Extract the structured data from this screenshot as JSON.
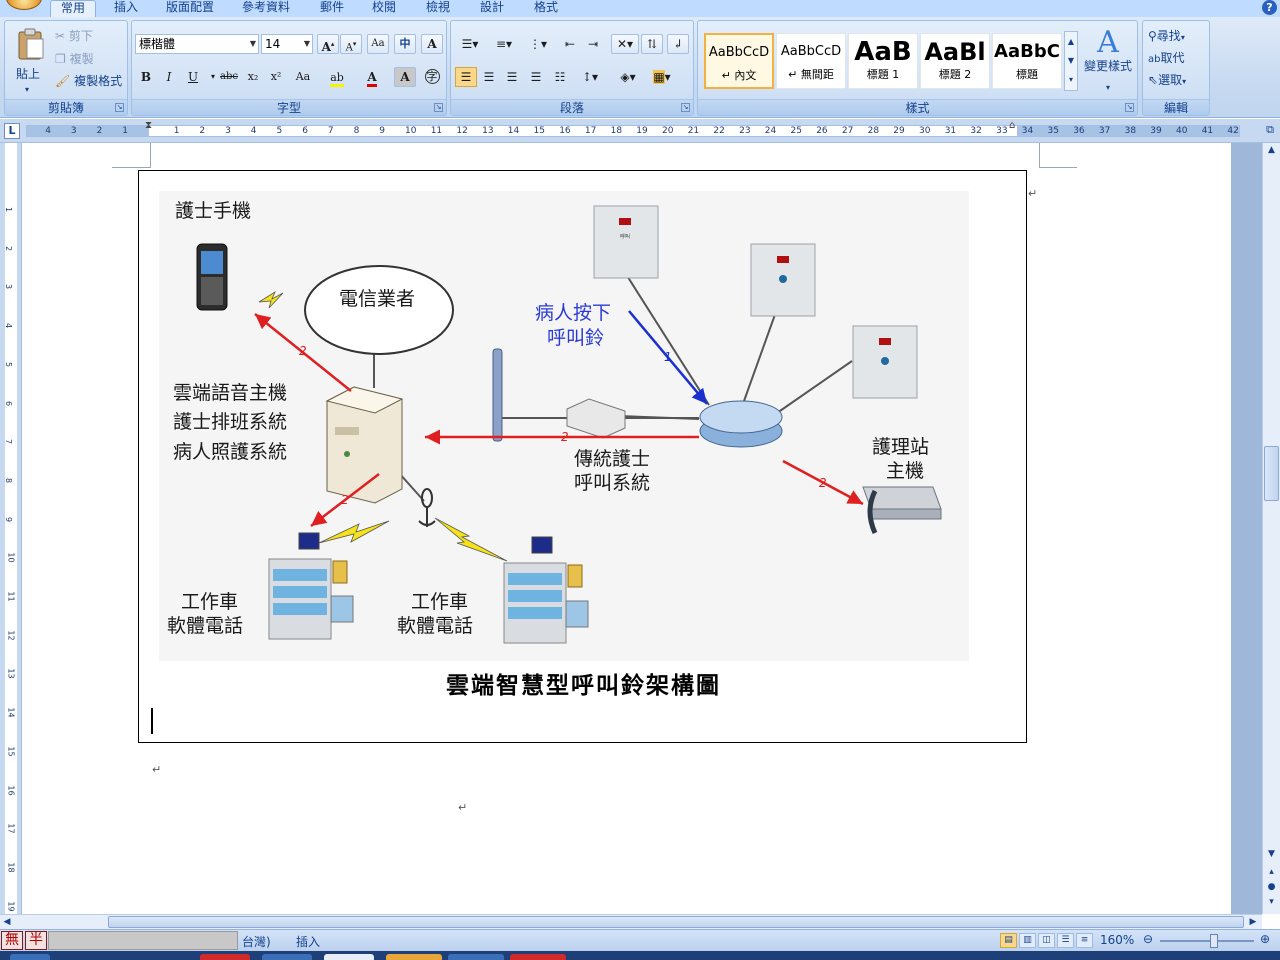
{
  "tabs": [
    "常用",
    "插入",
    "版面配置",
    "參考資料",
    "郵件",
    "校閱",
    "檢視",
    "設計",
    "格式"
  ],
  "help": "?",
  "clipboard": {
    "paste": "貼上",
    "cut": "剪下",
    "copy": "複製",
    "format_painter": "複製格式",
    "group": "剪貼簿"
  },
  "font": {
    "name": "標楷體",
    "size": "14",
    "group": "字型",
    "bold": "B",
    "italic": "I",
    "underline": "U",
    "strike": "abc",
    "subscript": "x₂",
    "superscript": "x²",
    "change_case": "Aa",
    "grow": "A",
    "shrink": "A",
    "font_color": "A",
    "char_shade": "A",
    "enclose": "字",
    "phonetic": "中"
  },
  "paragraph": {
    "group": "段落"
  },
  "styles": {
    "group": "樣式",
    "change": "變更樣式",
    "gallery": [
      {
        "preview": "AaBbCcD",
        "name": "↵ 內文"
      },
      {
        "preview": "AaBbCcD",
        "name": "↵ 無間距"
      },
      {
        "preview": "AaB",
        "name": "標題 1"
      },
      {
        "preview": "AaBl",
        "name": "標題 2"
      },
      {
        "preview": "AaBbC",
        "name": "標題"
      }
    ]
  },
  "editing": {
    "group": "編輯",
    "find": "尋找",
    "replace": "取代",
    "select": "選取"
  },
  "ruler": {
    "left_numbers": [
      "4",
      "3",
      "2",
      "1"
    ],
    "numbers": [
      "1",
      "2",
      "3",
      "4",
      "5",
      "6",
      "7",
      "8",
      "9",
      "10",
      "11",
      "12",
      "13",
      "14",
      "15",
      "16",
      "17",
      "18",
      "19",
      "20",
      "21",
      "22",
      "23",
      "24",
      "25",
      "26",
      "27",
      "28",
      "29",
      "30",
      "31",
      "32",
      "33",
      "34",
      "35",
      "36",
      "37",
      "38",
      "39",
      "40",
      "41",
      "42"
    ]
  },
  "vruler": [
    "1",
    "2",
    "3",
    "4",
    "5",
    "6",
    "7",
    "8",
    "9",
    "10",
    "11",
    "12",
    "13",
    "14",
    "15",
    "16",
    "17",
    "18",
    "19"
  ],
  "diagram": {
    "nurse_phone": "護士手機",
    "telecom": "電信業者",
    "host_line1": "雲端語音主機",
    "host_line2": "護士排班系統",
    "host_line3": "病人照護系統",
    "patient_press_1": "病人按下",
    "patient_press_2": "呼叫鈴",
    "traditional_1": "傳統護士",
    "traditional_2": "呼叫系統",
    "station_1": "護理站",
    "station_2": "主機",
    "cart_a_1": "工作車",
    "cart_a_2": "軟體電話",
    "cart_b_1": "工作車",
    "cart_b_2": "軟體電話",
    "label_1": "1",
    "label_2": "2",
    "caption": "雲端智慧型呼叫鈴架構圖"
  },
  "statusbar": {
    "ime_1": "無",
    "ime_2": "半",
    "language": "台灣)",
    "mode": "插入",
    "zoom": "160%"
  },
  "colors": {
    "ribbon_bg": "#c6d9f1",
    "accent_text": "#15428b",
    "arrow_red": "#e02020",
    "arrow_blue": "#1a2fd0"
  }
}
